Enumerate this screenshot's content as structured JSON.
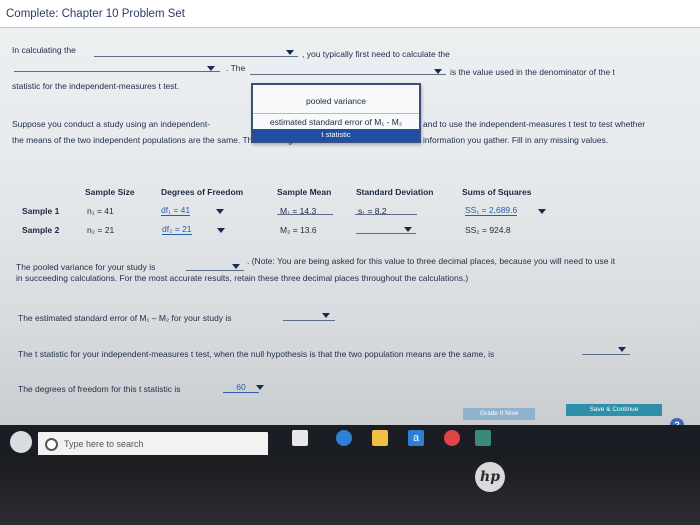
{
  "window": {
    "title": "Complete: Chapter 10 Problem Set"
  },
  "q1": {
    "line1_pre": "In calculating the",
    "line1_post": ", you typically first need to calculate the",
    "line2_mid": ". The",
    "line2_post": "is the value used in the denominator of the t",
    "line3": "statistic for the independent-measures t test."
  },
  "dropdown_options": {
    "opt1": "pooled variance",
    "opt2": "estimated standard error of M₁ - M₂",
    "opt3": "t statistic"
  },
  "scenario": {
    "line1_pre": "Suppose you conduct a study using an independent-",
    "line1_post": "and to use the independent-measures t test to test whether",
    "line2_pre": "the means of the two independent populations are the same. The following is a table of the",
    "line2_post": "information you gather. Fill in any missing values."
  },
  "table": {
    "headers": [
      "Sample Size",
      "Degrees of Freedom",
      "Sample Mean",
      "Standard Deviation",
      "Sums of Squares"
    ],
    "rows": [
      {
        "label": "Sample 1",
        "n": "n₁ = 41",
        "df": "df₁ = 41",
        "mean": "M₁ = 14.3",
        "sd": "s₁ = 8.2",
        "ss": "SS₁ = 2,689.6"
      },
      {
        "label": "Sample 2",
        "n": "n₂ = 21",
        "df": "df₂ = 21",
        "mean": "M₂ = 13.6",
        "sd": "",
        "ss": "SS₂ = 924.8"
      }
    ]
  },
  "pooled": {
    "pre": "The pooled variance for your study is",
    "post": ". (Note: You are being asked for this value to three decimal places, because you will need to use it",
    "line2": "in succeeding calculations. For the most accurate results, retain these three decimal places throughout the calculations.)"
  },
  "se": {
    "text": "The estimated standard error of M₁ – M₂ for your study is"
  },
  "tstat": {
    "text": "The t statistic for your independent-measures t test, when the null hypothesis is that the two population means are the same, is"
  },
  "dof": {
    "text": "The degrees of freedom for this t statistic is",
    "value": "60"
  },
  "buttons": {
    "grade": "Grade It Now",
    "save": "Save & Continue"
  },
  "taskbar": {
    "search_placeholder": "Type here to search"
  },
  "help": "?",
  "brand": "hp"
}
